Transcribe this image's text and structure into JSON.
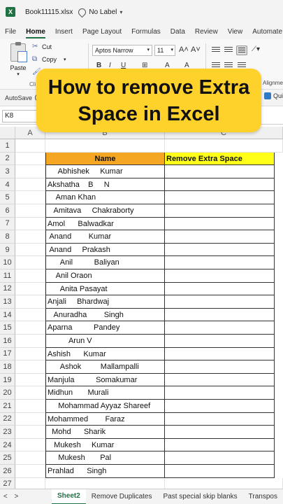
{
  "titlebar": {
    "app_icon": "X",
    "filename": "Book11115.xlsx",
    "label_text": "No Label"
  },
  "menu": {
    "tabs": [
      "File",
      "Home",
      "Insert",
      "Page Layout",
      "Formulas",
      "Data",
      "Review",
      "View",
      "Automate"
    ],
    "active": "Home"
  },
  "ribbon": {
    "paste_label": "Paste",
    "cut_label": "Cut",
    "copy_label": "Copy",
    "clipboard_group_label": "Cli",
    "font_name": "Aptos Narrow",
    "font_size": "11",
    "grow_glyph": "A˄",
    "shrink_glyph": "A˅",
    "bold": "B",
    "italic": "I",
    "underline": "U",
    "fill_glyph": "A",
    "font_color_glyph": "A",
    "alignment_group_label": "Alignme"
  },
  "autosave": {
    "label": "AutoSave",
    "quick_label": "Qui"
  },
  "formula_bar": {
    "name_box": "K8",
    "dots": "⋮"
  },
  "banner": {
    "line1": "How to remove Extra",
    "line2": "Space in Excel"
  },
  "grid": {
    "columns": [
      "A",
      "B",
      "C"
    ],
    "rows": [
      {
        "n": "1",
        "b": "",
        "c": ""
      },
      {
        "n": "2",
        "b": "Name",
        "c": "Remove Extra Space",
        "header": true
      },
      {
        "n": "3",
        "b": "     Abhishek     Kumar",
        "c": ""
      },
      {
        "n": "4",
        "b": "Akshatha    B     N",
        "c": ""
      },
      {
        "n": "5",
        "b": "    Aman Khan",
        "c": ""
      },
      {
        "n": "6",
        "b": "   Amitava     Chakraborty",
        "c": ""
      },
      {
        "n": "7",
        "b": "Amol      Balwadkar",
        "c": ""
      },
      {
        "n": "8",
        "b": " Anand        Kumar",
        "c": ""
      },
      {
        "n": "9",
        "b": " Anand     Prakash",
        "c": ""
      },
      {
        "n": "10",
        "b": "      Anil          Baliyan",
        "c": ""
      },
      {
        "n": "11",
        "b": "    Anil Oraon",
        "c": ""
      },
      {
        "n": "12",
        "b": "      Anita Pasayat",
        "c": ""
      },
      {
        "n": "13",
        "b": "Anjali     Bhardwaj",
        "c": ""
      },
      {
        "n": "14",
        "b": "   Anuradha        Singh",
        "c": ""
      },
      {
        "n": "15",
        "b": "Aparna          Pandey",
        "c": ""
      },
      {
        "n": "16",
        "b": "          Arun V",
        "c": ""
      },
      {
        "n": "17",
        "b": "Ashish      Kumar",
        "c": ""
      },
      {
        "n": "18",
        "b": "      Ashok         Mallampalli",
        "c": ""
      },
      {
        "n": "19",
        "b": "Manjula          Somakumar",
        "c": ""
      },
      {
        "n": "20",
        "b": "Midhun       Murali",
        "c": ""
      },
      {
        "n": "21",
        "b": "     Mohammad Ayyaz Shareef",
        "c": ""
      },
      {
        "n": "22",
        "b": "Mohammed        Faraz",
        "c": ""
      },
      {
        "n": "23",
        "b": "  Mohd      Sharik",
        "c": ""
      },
      {
        "n": "24",
        "b": "   Mukesh     Kumar",
        "c": ""
      },
      {
        "n": "25",
        "b": "     Mukesh       Pal",
        "c": ""
      },
      {
        "n": "26",
        "b": "Prahlad      Singh",
        "c": ""
      },
      {
        "n": "27",
        "b": "",
        "c": ""
      }
    ]
  },
  "sheets": {
    "tabs": [
      "Sheet2",
      "Remove Duplicates",
      "Past special skip blanks",
      "Transpos"
    ],
    "active": "Sheet2",
    "prev": "<",
    "next": ">"
  }
}
